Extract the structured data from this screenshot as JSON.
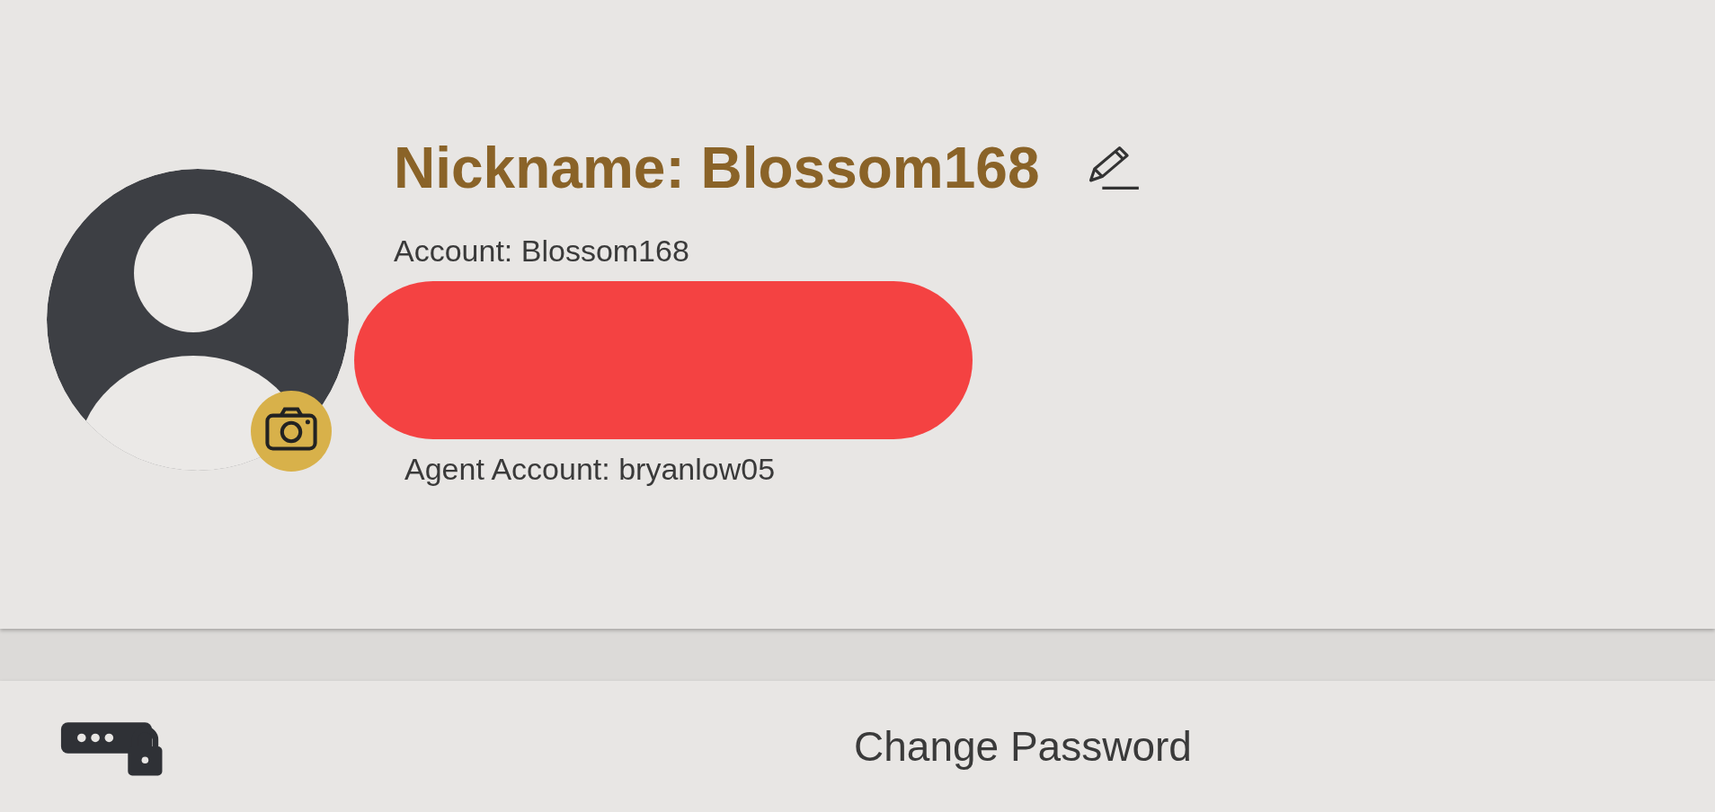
{
  "profile": {
    "nickname": "Nickname: Blossom168",
    "account": "Account: Blossom168",
    "agent_account": "Agent Account: bryanlow05"
  },
  "actions": [
    {
      "label": "Change Password"
    }
  ]
}
